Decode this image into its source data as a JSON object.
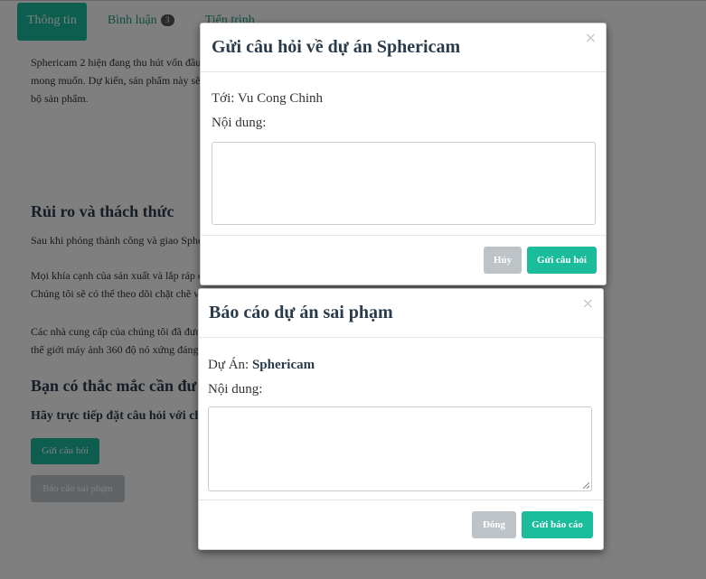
{
  "tabs": [
    {
      "label": "Thông tin"
    },
    {
      "label": "Bình luận",
      "badge": "3"
    },
    {
      "label": "Tiến trình"
    }
  ],
  "background": {
    "intro_lines": [
      "Sphericam 2 hiện đang thu hút vốn đầu",
      "mong muốn. Dự kiến, sản phẩm này sẽ",
      "bộ sản phẩm."
    ],
    "risk_heading": "Rủi ro và thách thức",
    "risk_line1": "Sau khi phóng thành công và giao Sphe",
    "risk_line2a": "Mọi khía cạnh của sản xuất và lắp ráp c",
    "risk_line2b": "Chúng tôi sẽ có thể theo dõi chặt chẽ và",
    "risk_line3a": "Các nhà cung cấp của chúng tôi đã đượ",
    "risk_line3b": "thế giới máy ảnh 360 độ nó xứng đáng.",
    "question_heading": "Bạn có thắc mắc cần đư",
    "question_sub": "Hãy trực tiếp đặt câu hỏi với chủ",
    "ask_button": "Gửi câu hỏi",
    "report_button": "Báo cáo sai phạm"
  },
  "question_modal": {
    "title": "Gửi câu hỏi về dự án Sphericam",
    "to_label": "Tới: Vu Cong Chinh",
    "content_label": "Nội dung:",
    "textarea_value": "",
    "cancel_label": "Hủy",
    "submit_label": "Gửi câu hỏi",
    "close_glyph": "×"
  },
  "report_modal": {
    "title": "Báo cáo dự án sai phạm",
    "project_prefix": "Dự Án: ",
    "project_name": "Sphericam",
    "content_label": "Nội dung:",
    "textarea_value": "",
    "close_label": "Đóng",
    "submit_label": "Gửi báo cáo",
    "close_glyph": "×"
  },
  "colors": {
    "accent": "#1abc9c",
    "title": "#2a3b4c",
    "disabled": "#bdc3c7"
  }
}
